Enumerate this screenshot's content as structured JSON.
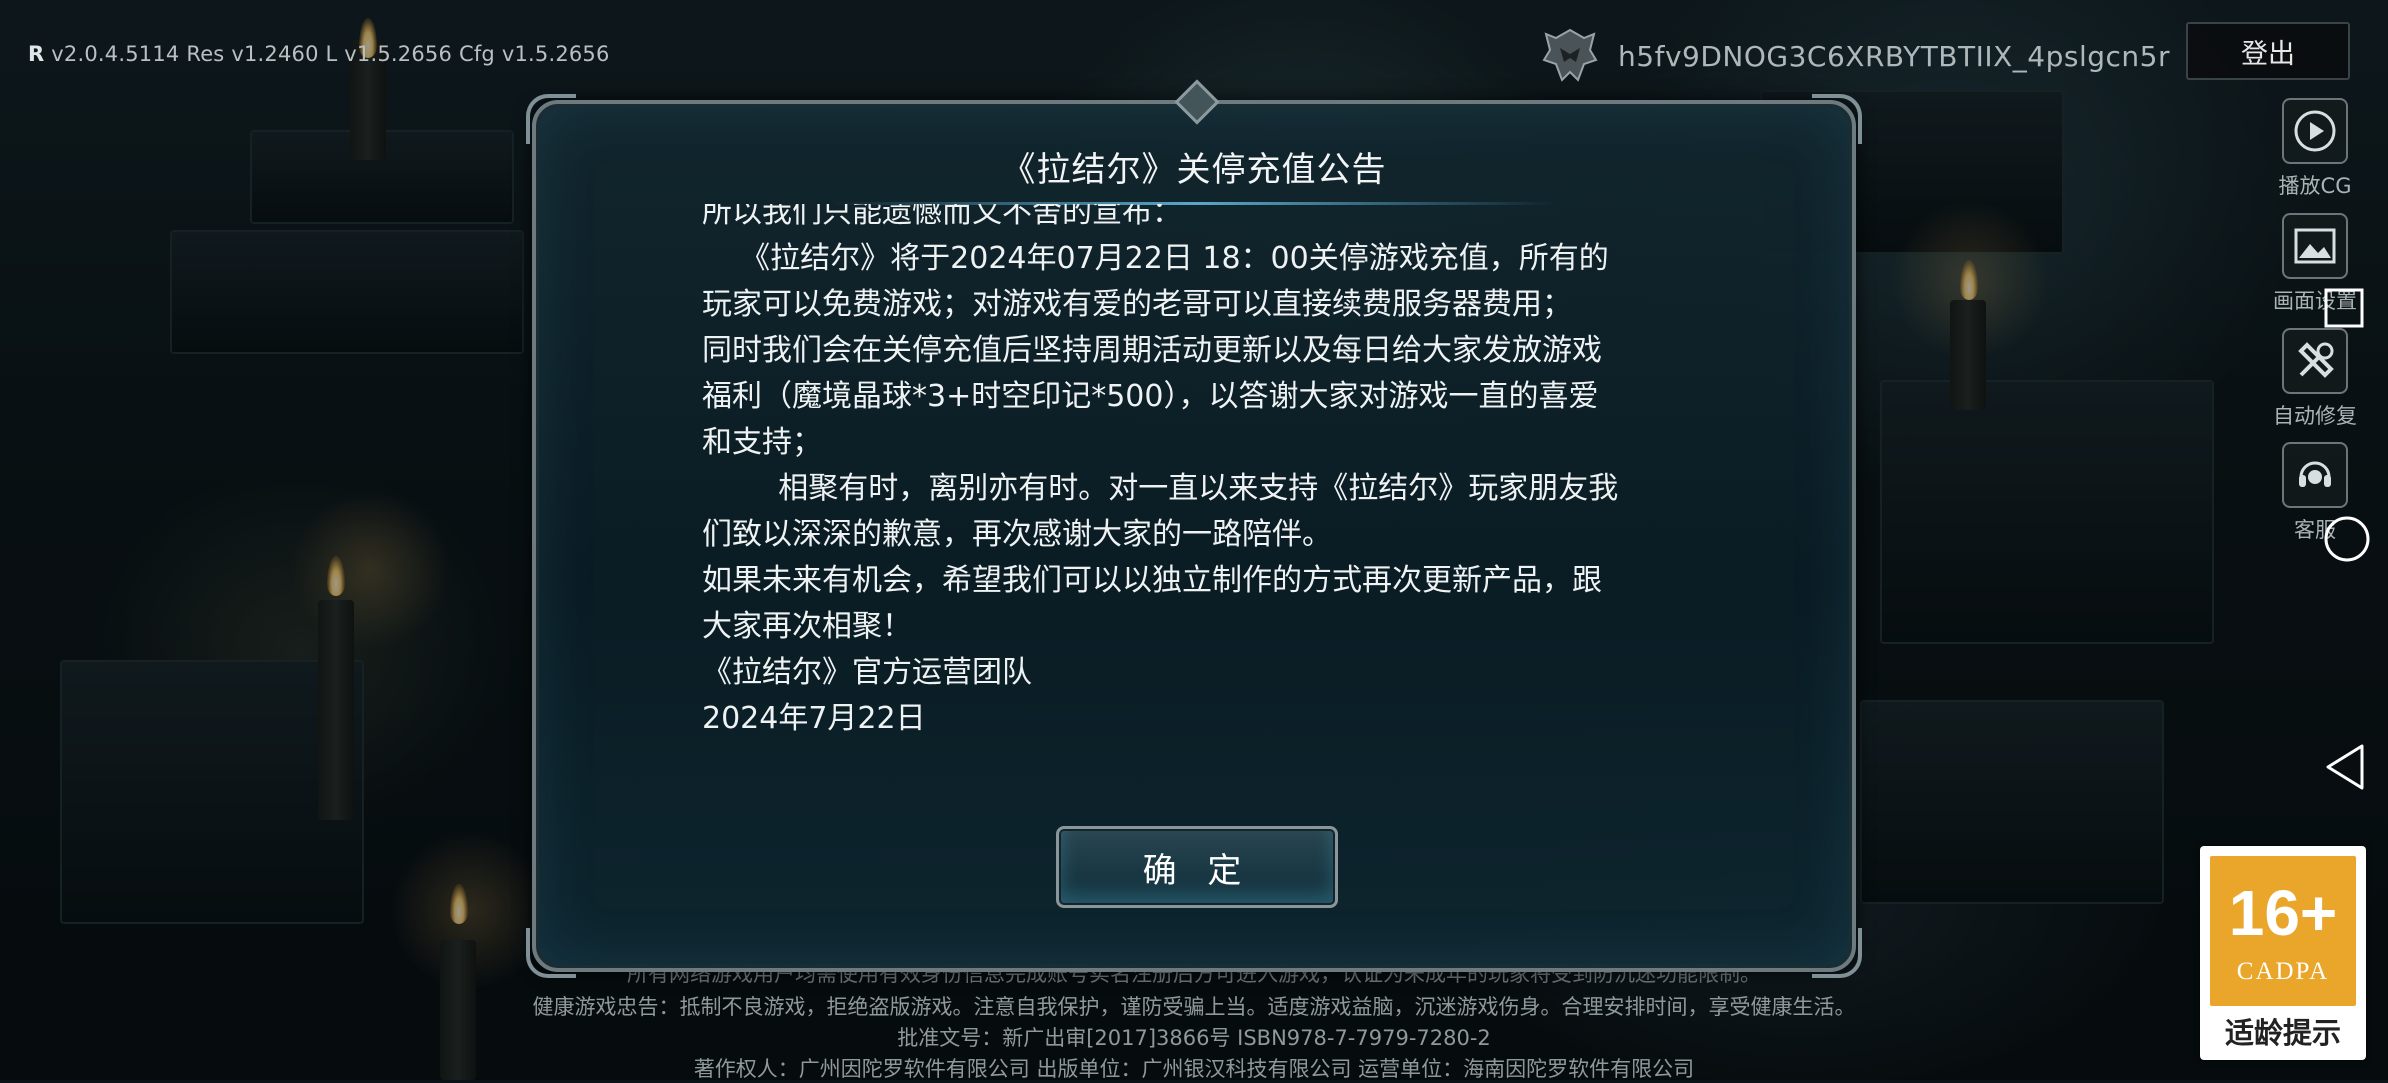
{
  "version": {
    "r": "R",
    "r_val": "v2.0.4.5114",
    "res": "Res v1.2460",
    "l": "L v1.5.2656",
    "cfg": "Cfg v1.5.2656"
  },
  "account": {
    "id": "h5fv9DNOG3C6XRBYTBTIIX_4pslgcn5r",
    "logout_label": "登出"
  },
  "side_menu": [
    {
      "label": "播放CG",
      "icon": "play-icon"
    },
    {
      "label": "画面设置",
      "icon": "image-icon"
    },
    {
      "label": "自动修复",
      "icon": "repair-tools-icon"
    },
    {
      "label": "客服",
      "icon": "headset-icon"
    }
  ],
  "modal": {
    "title": "《拉结尔》关停充值公告",
    "lines": [
      "所以我们只能遗憾而又不舍的宣布：",
      "    《拉结尔》将于2024年07月22日 18：00关停游戏充值，所有的",
      "玩家可以免费游戏；对游戏有爱的老哥可以直接续费服务器费用；",
      "同时我们会在关停充值后坚持周期活动更新以及每日给大家发放游戏",
      "福利（魔境晶球*3+时空印记*500），以答谢大家对游戏一直的喜爱",
      "和支持；",
      "        相聚有时，离别亦有时。对一直以来支持《拉结尔》玩家朋友我",
      "们致以深深的歉意，再次感谢大家的一路陪伴。",
      "如果未来有机会，希望我们可以以独立制作的方式再次更新产品，跟",
      "大家再次相聚！",
      "",
      "《拉结尔》官方运营团队",
      "2024年7月22日"
    ],
    "confirm_label": "确 定"
  },
  "footer": {
    "line1": "所有网络游戏用户均需使用有效身份信息完成账号实名注册后方可进入游戏，认证为未成年的玩家将受到防沉迷功能限制。",
    "line2": "健康游戏忠告：抵制不良游戏，拒绝盗版游戏。注意自我保护，谨防受骗上当。适度游戏益脑，沉迷游戏伤身。合理安排时间，享受健康生活。",
    "line3": "批准文号：新广出审[2017]3866号  ISBN978-7-7979-7280-2",
    "line4": "著作权人：广州因陀罗软件有限公司  出版单位：广州银汉科技有限公司  运营单位：海南因陀罗软件有限公司"
  },
  "age_rating": {
    "number": "16+",
    "org": "CADPA",
    "tip": "适龄提示"
  },
  "colors": {
    "modal_bg": "#0f2730",
    "modal_border": "#6b7b80",
    "button_glow": "#5abedc",
    "age_badge": "#e9a62a"
  }
}
